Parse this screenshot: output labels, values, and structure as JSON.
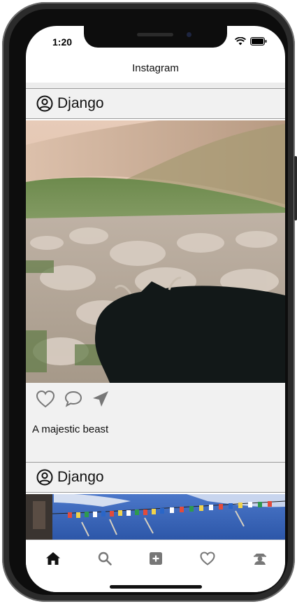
{
  "status_bar": {
    "time": "1:20"
  },
  "nav": {
    "title": "Instagram"
  },
  "posts": [
    {
      "username": "Django",
      "caption": "A majestic beast"
    },
    {
      "username": "Django"
    }
  ],
  "icons": {
    "like": "heart-icon",
    "comment": "comment-icon",
    "share": "send-icon",
    "tabs": [
      "home-icon",
      "search-icon",
      "add-icon",
      "heart-icon",
      "profile-icon"
    ]
  },
  "colors": {
    "header_bg": "#f1f1f1",
    "icon_gray": "#777777",
    "active_tab": "#111111"
  }
}
